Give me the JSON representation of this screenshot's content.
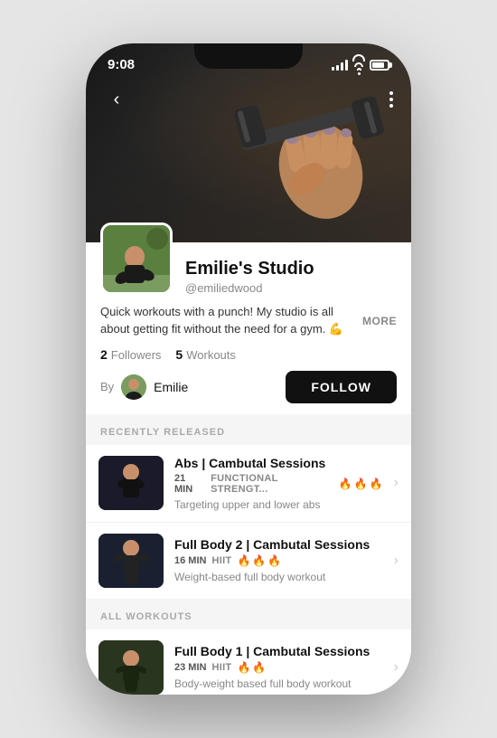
{
  "statusBar": {
    "time": "9:08"
  },
  "hero": {
    "imageAlt": "person holding dumbbell"
  },
  "nav": {
    "backLabel": "<",
    "moreLabel": "⋮"
  },
  "profile": {
    "studioName": "Emilie's Studio",
    "handle": "@emiliedwood",
    "bio": "Quick workouts with a punch! My studio is all about getting fit without the need for a gym. 💪",
    "moreLabel": "MORE",
    "followersCount": "2",
    "followersLabel": "Followers",
    "workoutsCount": "5",
    "workoutsLabel": "Workouts",
    "byLabel": "By",
    "creatorName": "Emilie",
    "followLabel": "FOLLOW"
  },
  "sections": {
    "recentlyReleased": {
      "label": "RECENTLY RELEASED",
      "workouts": [
        {
          "title": "Abs | Cambutal Sessions",
          "duration": "21 MIN",
          "type": "FUNCTIONAL STRENGT...",
          "flames": "🔥🔥🔥",
          "description": "Targeting upper and lower abs"
        },
        {
          "title": "Full Body 2 | Cambutal Sessions",
          "duration": "16 MIN",
          "type": "HIIT",
          "flames": "🔥🔥🔥",
          "description": "Weight-based full body workout"
        }
      ]
    },
    "allWorkouts": {
      "label": "ALL WORKOUTS",
      "workouts": [
        {
          "title": "Full Body 1 | Cambutal Sessions",
          "duration": "23 MIN",
          "type": "HIIT",
          "flames": "🔥🔥",
          "description": "Body-weight based full body workout"
        }
      ]
    }
  }
}
